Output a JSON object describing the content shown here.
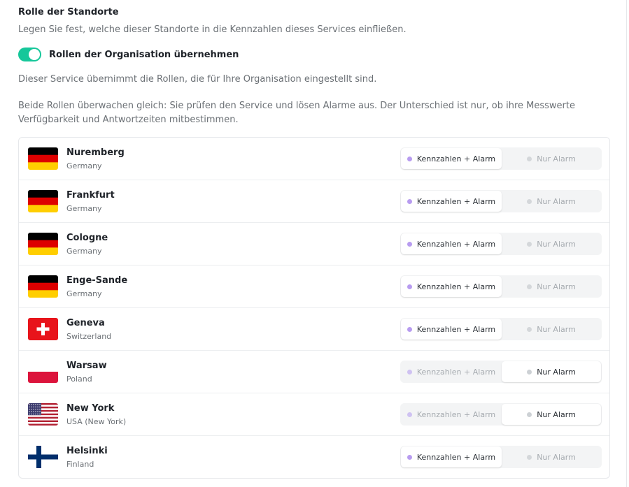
{
  "section": {
    "title": "Rolle der Standorte",
    "description": "Legen Sie fest, welche dieser Standorte in die Kennzahlen dieses Services einfließen.",
    "toggle_label": "Rollen der Organisation übernehmen",
    "toggle_on": true,
    "info1": "Dieser Service übernimmt die Rollen, die für Ihre Organisation eingestellt sind.",
    "info2": "Beide Rollen überwachen gleich: Sie prüfen den Service und lösen Alarme aus. Der Unterschied ist nur, ob ihre Messwerte Verfügbarkeit und Antwortzeiten mitbestimmen."
  },
  "options": {
    "metrics_alarm": "Kennzahlen + Alarm",
    "alarm_only": "Nur Alarm"
  },
  "colors": {
    "toggle": "#16c79a",
    "metrics_dot": "#b89cf0",
    "alarm_dot": "#cdd1d5"
  },
  "locations": [
    {
      "city": "Nuremberg",
      "country": "Germany",
      "flag": "germany-flag-icon",
      "role": "metrics_alarm"
    },
    {
      "city": "Frankfurt",
      "country": "Germany",
      "flag": "germany-flag-icon",
      "role": "metrics_alarm"
    },
    {
      "city": "Cologne",
      "country": "Germany",
      "flag": "germany-flag-icon",
      "role": "metrics_alarm"
    },
    {
      "city": "Enge-Sande",
      "country": "Germany",
      "flag": "germany-flag-icon",
      "role": "metrics_alarm"
    },
    {
      "city": "Geneva",
      "country": "Switzerland",
      "flag": "switzerland-flag-icon",
      "role": "metrics_alarm"
    },
    {
      "city": "Warsaw",
      "country": "Poland",
      "flag": "poland-flag-icon",
      "role": "alarm_only"
    },
    {
      "city": "New York",
      "country": "USA (New York)",
      "flag": "usa-flag-icon",
      "role": "alarm_only"
    },
    {
      "city": "Helsinki",
      "country": "Finland",
      "flag": "finland-flag-icon",
      "role": "metrics_alarm"
    }
  ]
}
